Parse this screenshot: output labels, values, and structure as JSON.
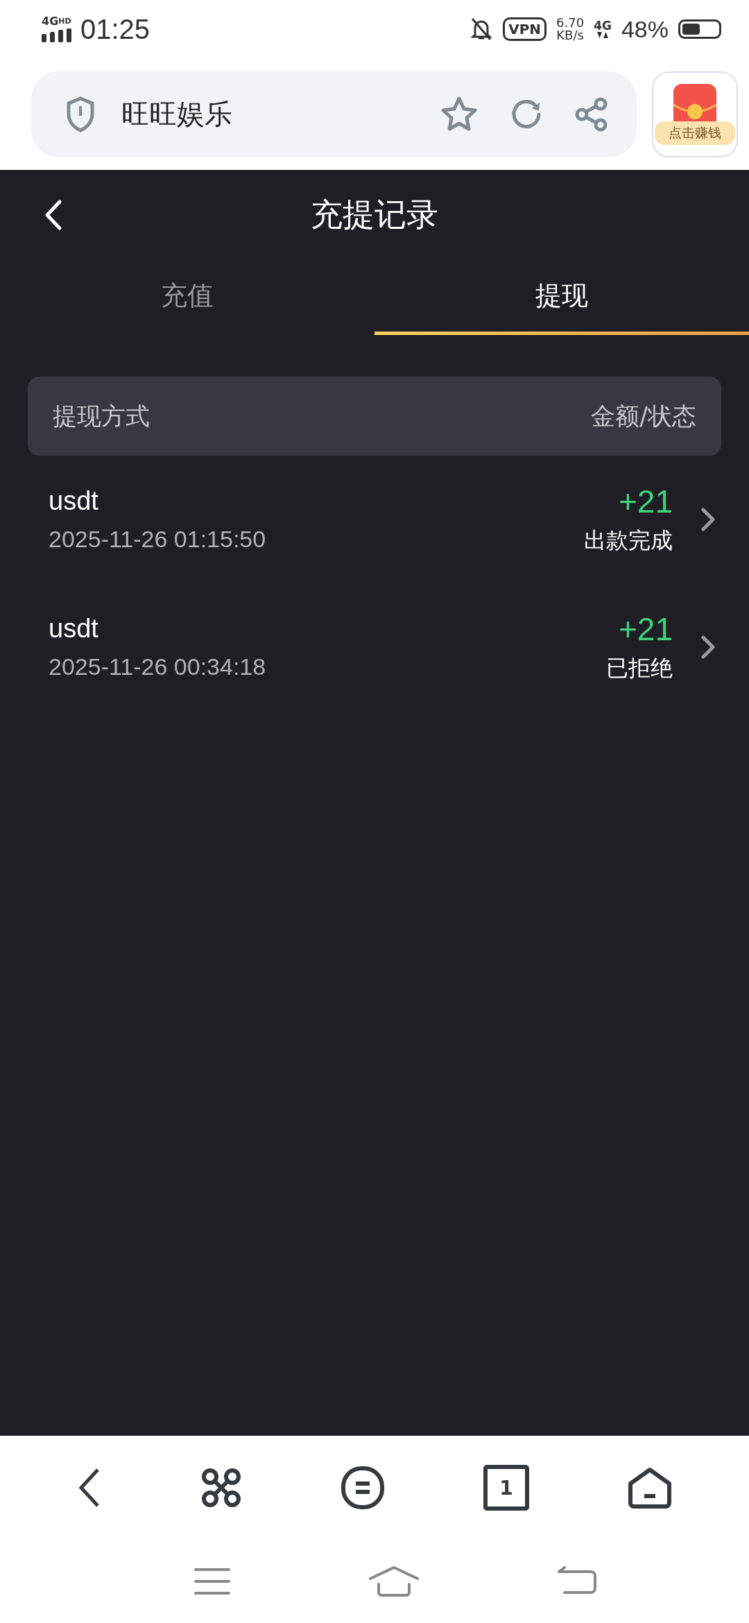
{
  "status_bar": {
    "network": "4G",
    "network_badge": "HD",
    "time": "01:25",
    "vpn": "VPN",
    "speed": "6.70",
    "speed_unit": "KB/s",
    "data_type": "4G",
    "battery": "48%"
  },
  "address_bar": {
    "site_name": "旺旺娱乐"
  },
  "reward_button": {
    "label": "点击赚钱"
  },
  "header": {
    "title": "充提记录"
  },
  "tabs": [
    {
      "label": "充值",
      "selected": false
    },
    {
      "label": "提现",
      "selected": true
    }
  ],
  "table": {
    "columns": [
      "提现方式",
      "金额/状态"
    ],
    "rows": [
      {
        "method": "usdt",
        "time": "2025-11-26 01:15:50",
        "amount": "+21",
        "status": "出款完成"
      },
      {
        "method": "usdt",
        "time": "2025-11-26 00:34:18",
        "amount": "+21",
        "status": "已拒绝"
      }
    ]
  },
  "toolbar": {
    "tab_count": "1"
  }
}
